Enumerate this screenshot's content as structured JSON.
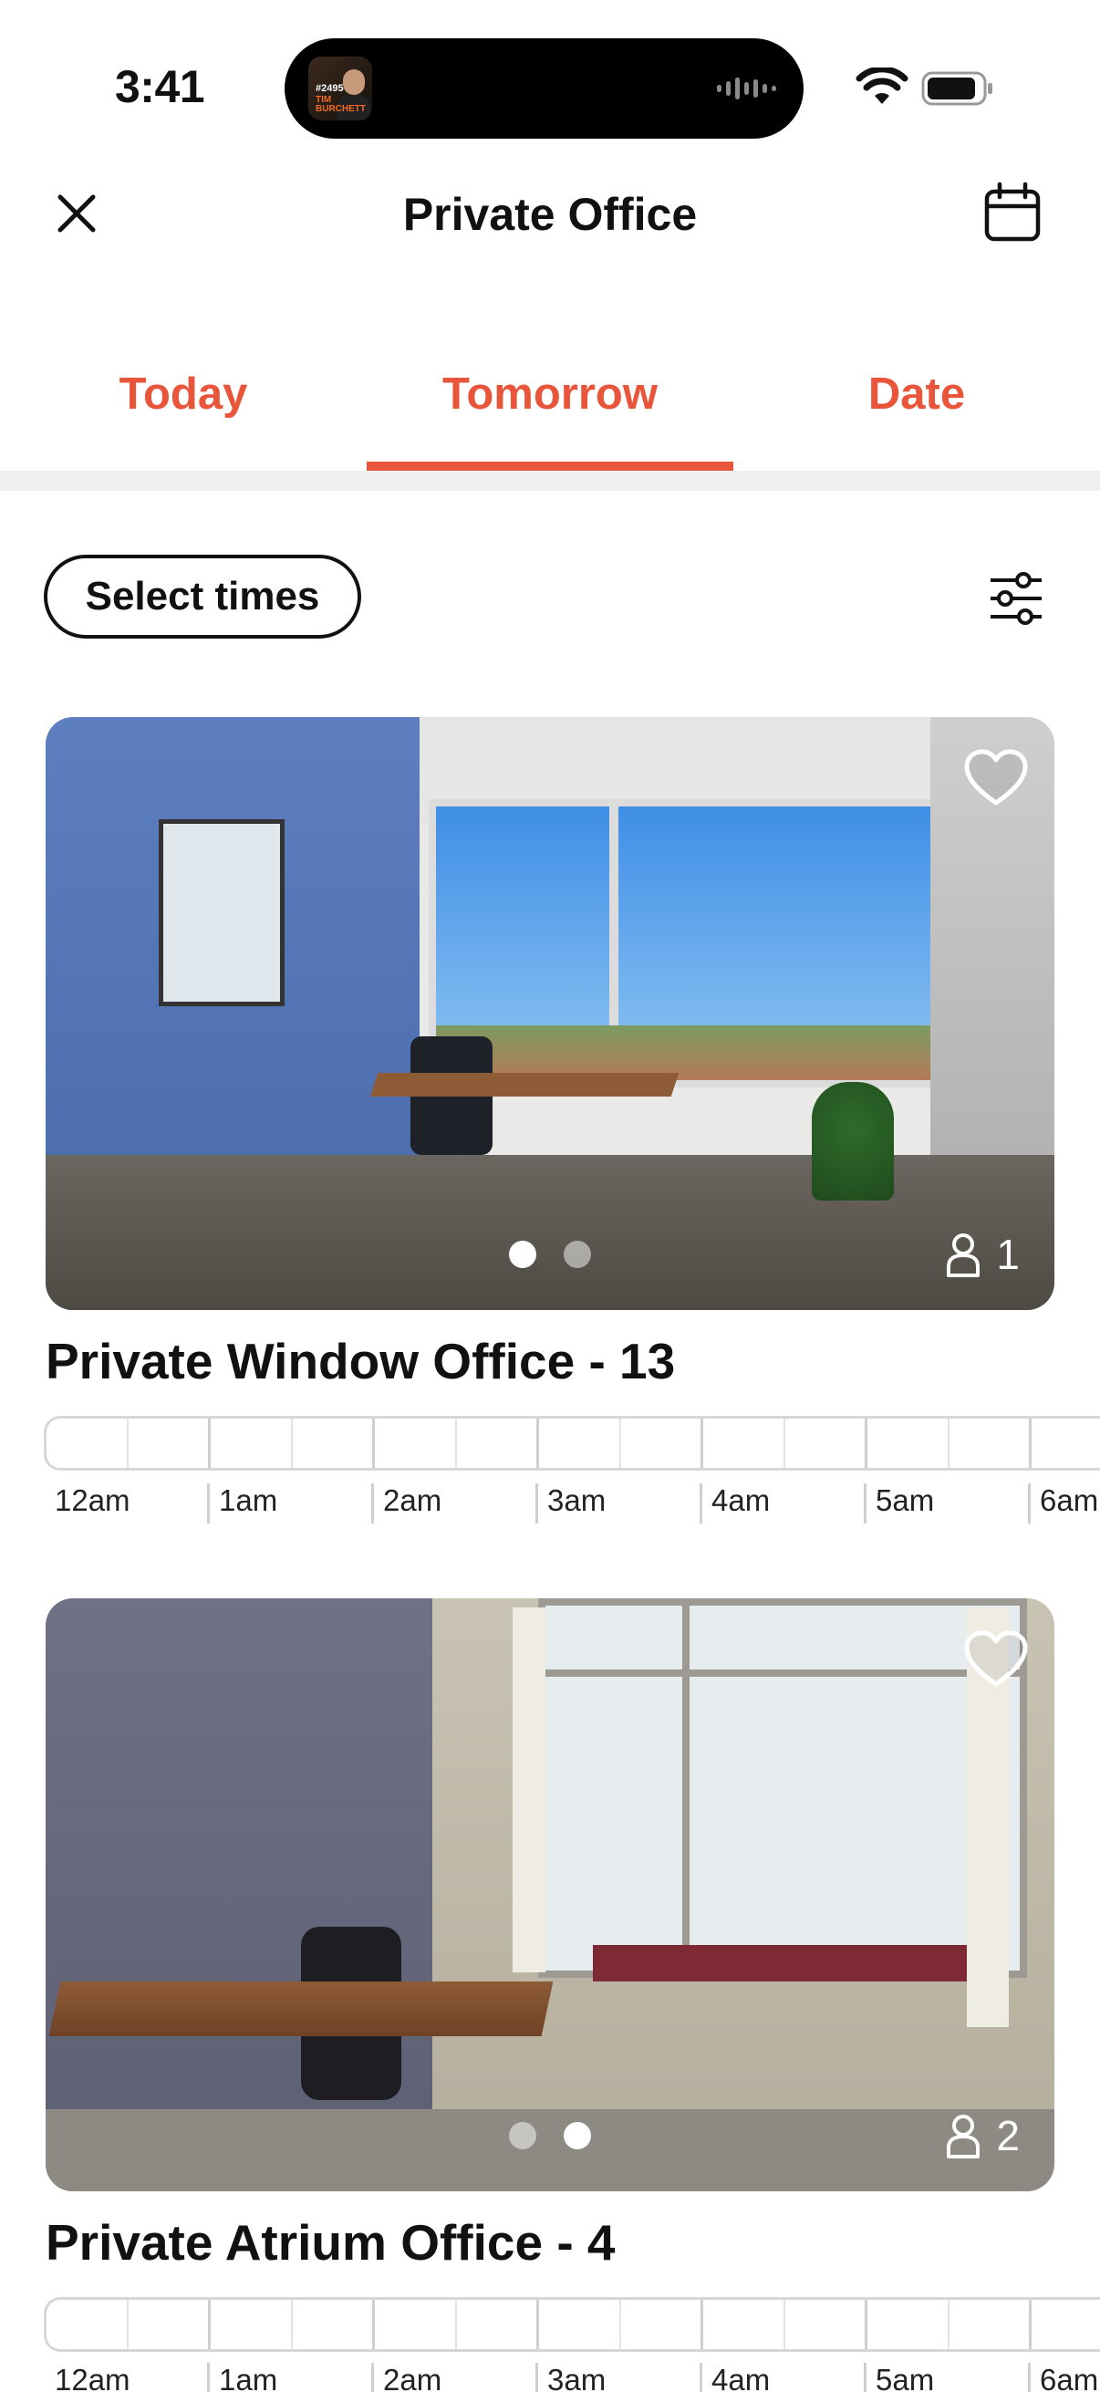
{
  "status_bar": {
    "time": "3:41",
    "now_playing": {
      "badge": "#2495",
      "name": "TIM BURCHETT"
    }
  },
  "header": {
    "title": "Private Office"
  },
  "tabs": [
    {
      "label": "Today",
      "selected": false
    },
    {
      "label": "Tomorrow",
      "selected": true
    },
    {
      "label": "Date",
      "selected": false
    }
  ],
  "toolbar": {
    "select_times_label": "Select times"
  },
  "colors": {
    "accent": "#e8553a",
    "text": "#111111"
  },
  "icons": {
    "close": "close-icon",
    "calendar": "calendar-icon",
    "filter": "sliders-icon",
    "favorite": "heart-icon",
    "capacity": "person-icon"
  },
  "listings": [
    {
      "title": "Private Window Office - 13",
      "capacity": "1",
      "photo_count": 2,
      "active_photo": 0,
      "favorited": false,
      "hours": [
        "12am",
        "1am",
        "2am",
        "3am",
        "4am",
        "5am",
        "6am"
      ]
    },
    {
      "title": "Private Atrium Office - 4",
      "capacity": "2",
      "photo_count": 2,
      "active_photo": 1,
      "favorited": false,
      "hours": [
        "12am",
        "1am",
        "2am",
        "3am",
        "4am",
        "5am",
        "6am"
      ]
    }
  ]
}
